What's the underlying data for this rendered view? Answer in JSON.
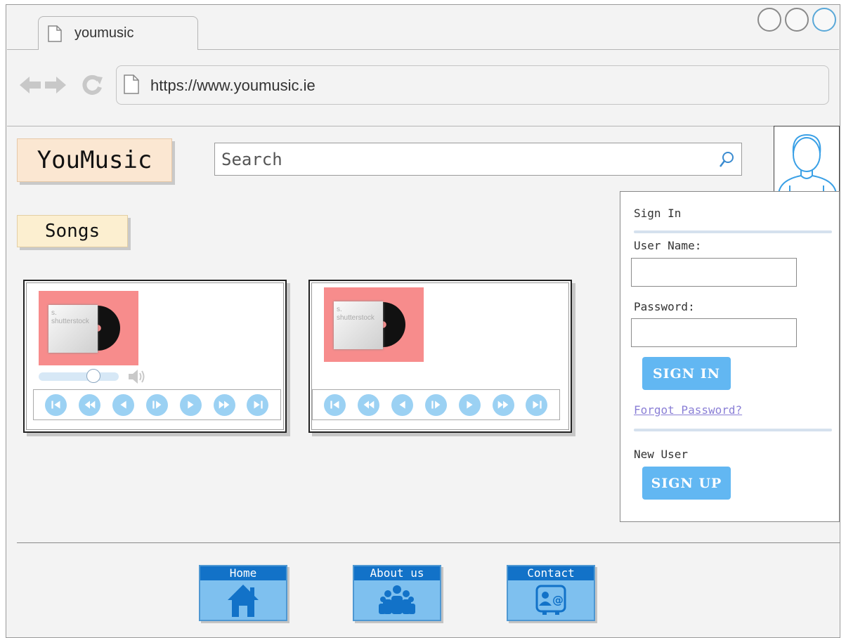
{
  "browser": {
    "tab_title": "youmusic",
    "url": "https://www.youmusic.ie"
  },
  "header": {
    "logo": "YouMusic",
    "search_placeholder": "Search"
  },
  "nav": {
    "songs_label": "Songs"
  },
  "songs": [
    {
      "cover_text": "s.\nshutterstock",
      "volume_fraction": 0.68
    },
    {
      "cover_text": "s.\nshutterstock"
    }
  ],
  "player_controls": [
    "skip-back-icon",
    "rewind-icon",
    "previous-icon",
    "play-pause-icon",
    "next-icon",
    "fast-forward-icon",
    "skip-forward-icon"
  ],
  "signin": {
    "title": "Sign In",
    "username_label": "User Name:",
    "password_label": "Password:",
    "signin_button": "SIGN IN",
    "forgot_link": "Forgot Password?",
    "new_user_label": "New User",
    "signup_button": "SIGN UP"
  },
  "footer": {
    "home_label": "Home",
    "about_label": "About us",
    "contact_label": "Contact"
  },
  "colors": {
    "accent_button": "#62b7f2",
    "control_circle": "#9bd1f3",
    "album_bg": "#f78c8c",
    "footer_header": "#1272c8"
  }
}
